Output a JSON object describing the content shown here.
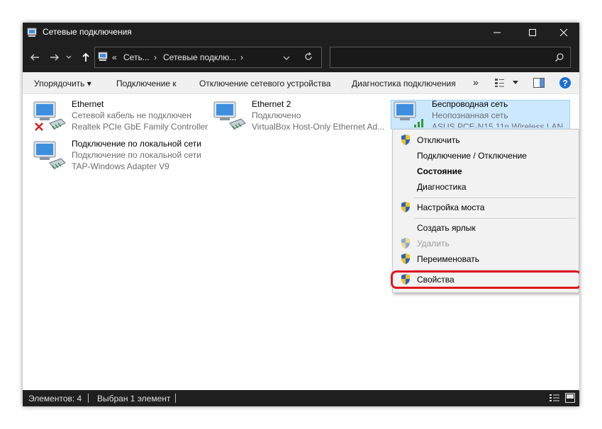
{
  "window": {
    "title": "Сетевые подключения"
  },
  "nav": {
    "breadcrumb_prefix": "«",
    "crumb1": "Сеть...",
    "crumb2": "Сетевые подклю...",
    "sep": "›",
    "search_placeholder": ""
  },
  "commands": {
    "organize": "Упорядочить",
    "connect_to": "Подключение к",
    "disable_device": "Отключение сетевого устройства",
    "diagnose": "Диагностика подключения",
    "more": "»"
  },
  "connections": [
    {
      "name": "Ethernet",
      "status": "Сетевой кабель не подключен",
      "adapter": "Realtek PCIe GbE Family Controller"
    },
    {
      "name": "Ethernet 2",
      "status": "Подключено",
      "adapter": "VirtualBox Host-Only Ethernet Ad..."
    },
    {
      "name": "Беспроводная сеть",
      "status": "Неопознанная сеть",
      "adapter": "ASUS PCE-N15 11n Wireless LAN ..."
    },
    {
      "name": "Подключение по локальной сети",
      "status": "Подключение по локальной сети",
      "adapter": "TAP-Windows Adapter V9"
    }
  ],
  "context_menu": {
    "disable": "Отключить",
    "connect_disconnect": "Подключение / Отключение",
    "status": "Состояние",
    "diagnostics": "Диагностика",
    "bridge": "Настройка моста",
    "shortcut": "Создать ярлык",
    "delete": "Удалить",
    "rename": "Переименовать",
    "properties": "Свойства"
  },
  "status": {
    "items": "Элементов: 4",
    "selected": "Выбран 1 элемент"
  },
  "colors": {
    "titlebar": "#1f1f1f",
    "selection": "#cce8ff",
    "highlight": "#e0161d",
    "accent": "#1c6fd1"
  }
}
